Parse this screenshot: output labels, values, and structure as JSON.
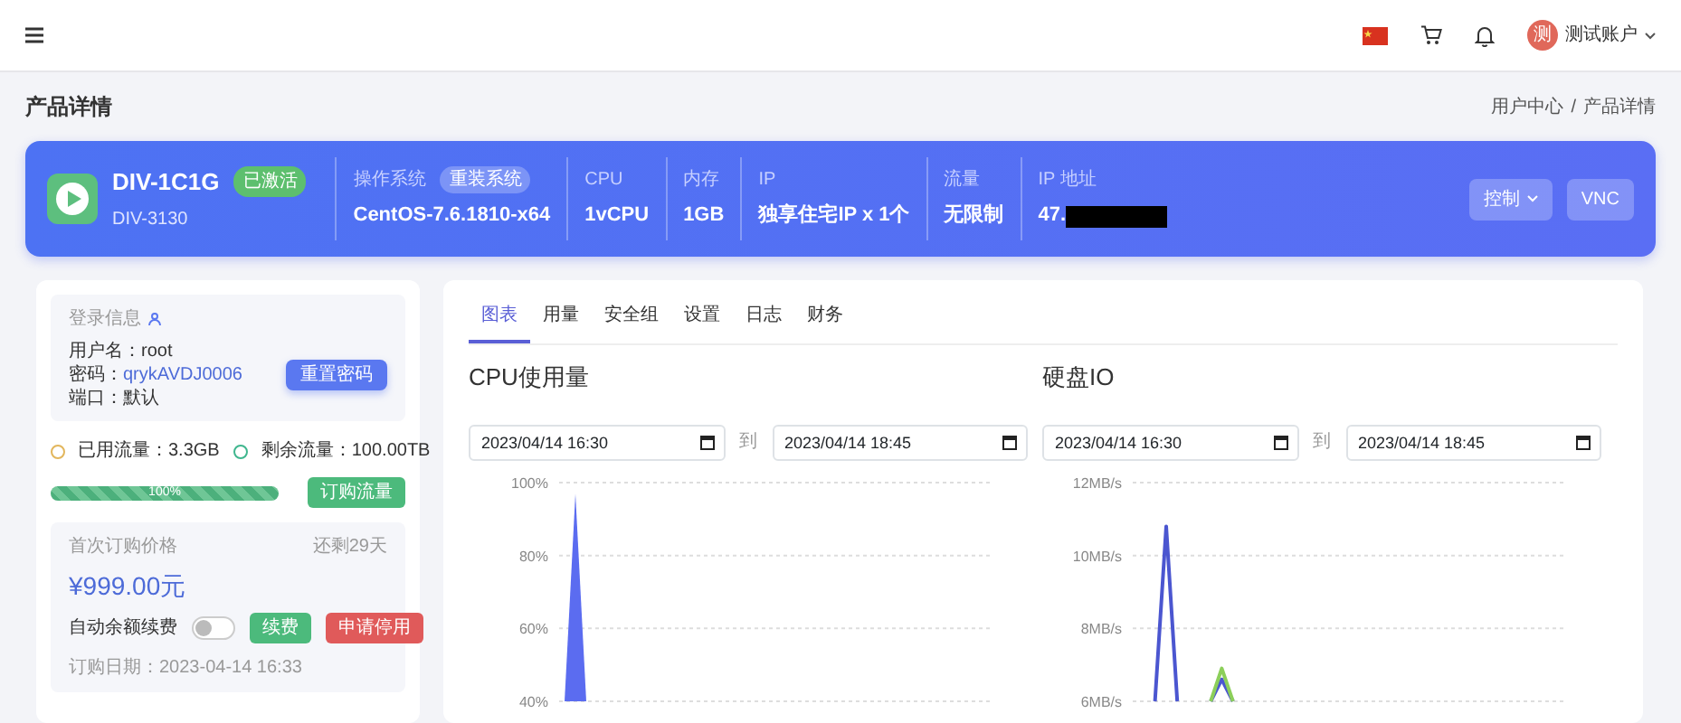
{
  "topbar": {
    "account": "测试账户",
    "avatar": "测"
  },
  "page": {
    "title": "产品详情",
    "breadcrumb": [
      "用户中心",
      "产品详情"
    ],
    "separator": "/"
  },
  "product": {
    "name": "DIV-1C1G",
    "status": "已激活",
    "id": "DIV-3130",
    "specs": [
      {
        "label": "操作系统",
        "value": "CentOS-7.6.1810-x64",
        "action": "重装系统",
        "redacted": false
      },
      {
        "label": "CPU",
        "value": "1vCPU",
        "redacted": false
      },
      {
        "label": "内存",
        "value": "1GB",
        "redacted": false
      },
      {
        "label": "IP",
        "value": "独享住宅IP x 1个",
        "redacted": false
      },
      {
        "label": "流量",
        "value": "无限制",
        "redacted": false
      },
      {
        "label": "IP 地址",
        "value": "47.",
        "redacted": true
      }
    ],
    "buttons": [
      {
        "label": "控制",
        "dropdown": true
      },
      {
        "label": "VNC",
        "dropdown": false
      }
    ]
  },
  "login_info": {
    "title": "登录信息",
    "lines": [
      {
        "label": "用户名：",
        "value": "root",
        "link": false
      },
      {
        "label": "密码：",
        "value": "qrykAVDJ0006",
        "link": true
      },
      {
        "label": "端口：",
        "value": "默认",
        "link": false
      }
    ],
    "button": "重置密码"
  },
  "traffic": {
    "legend": [
      {
        "text": "已用流量：3.3GB",
        "color": "#e2b65c"
      },
      {
        "text": "剩余流量：100.00TB",
        "color": "#3fb68e"
      }
    ],
    "level": 1.0,
    "label": "100%",
    "button": "订购流量"
  },
  "billing": {
    "title": "首次订购价格",
    "remaining": "还剩29天",
    "price": "¥999.00元",
    "auto_renew": {
      "label": "自动余额续费",
      "on": false
    },
    "buttons": [
      {
        "label": "续费",
        "kind": "success"
      },
      {
        "label": "申请停用",
        "kind": "danger"
      }
    ],
    "order_date": "订购日期：2023-04-14 16:33"
  },
  "tabs": [
    {
      "label": "图表",
      "selected": true
    },
    {
      "label": "用量",
      "selected": false
    },
    {
      "label": "安全组",
      "selected": false
    },
    {
      "label": "设置",
      "selected": false
    },
    {
      "label": "日志",
      "selected": false
    },
    {
      "label": "财务",
      "selected": false
    }
  ],
  "charts": [
    {
      "title": "CPU使用量",
      "from": "2023/04/14 16:30",
      "separator": "到",
      "to": "2023/04/14 18:45",
      "chart_data": {
        "type": "area",
        "grid": true,
        "ylim": [
          40,
          100
        ],
        "yticks": [
          {
            "value": 40,
            "label": "40%"
          },
          {
            "value": 60,
            "label": "60%"
          },
          {
            "value": 80,
            "label": "80%"
          },
          {
            "value": 100,
            "label": "100%"
          }
        ],
        "series": [
          {
            "color": "#5b6cf0",
            "values": [
              40,
              97,
              40,
              null,
              null,
              null,
              null,
              null,
              null,
              null,
              null,
              null,
              null,
              null,
              null,
              null,
              null,
              null,
              null,
              null,
              null,
              null,
              null,
              null,
              null,
              null,
              null,
              null,
              null,
              null,
              null,
              null,
              null,
              null,
              null,
              null,
              null,
              null,
              null,
              null
            ]
          }
        ]
      }
    },
    {
      "title": "硬盘IO",
      "from": "2023/04/14 16:30",
      "separator": "到",
      "to": "2023/04/14 18:45",
      "chart_data": {
        "type": "line",
        "grid": true,
        "ylim": [
          6,
          12
        ],
        "yticks": [
          {
            "value": 6,
            "label": "6MB/s"
          },
          {
            "value": 8,
            "label": "8MB/s"
          },
          {
            "value": 10,
            "label": "10MB/s"
          },
          {
            "value": 12,
            "label": "12MB/s"
          }
        ],
        "series": [
          {
            "color": "#4b56d0",
            "values": [
              null,
              null,
              6,
              10.8,
              6,
              null,
              null,
              6,
              6.6,
              6,
              null,
              null,
              null,
              null,
              null,
              null,
              null,
              null,
              null,
              null,
              null,
              null,
              null,
              null,
              null,
              null,
              null,
              null,
              null,
              null,
              null,
              null,
              null,
              null,
              null,
              null,
              null,
              null,
              null,
              null
            ]
          },
          {
            "color": "#8ccf5a",
            "values": [
              null,
              null,
              null,
              null,
              null,
              null,
              null,
              6,
              6.9,
              6,
              null,
              null,
              null,
              null,
              null,
              null,
              null,
              null,
              null,
              null,
              null,
              null,
              null,
              null,
              null,
              null,
              null,
              null,
              null,
              null,
              null,
              null,
              null,
              null,
              null,
              null,
              null,
              null,
              null,
              null
            ]
          }
        ]
      }
    }
  ]
}
